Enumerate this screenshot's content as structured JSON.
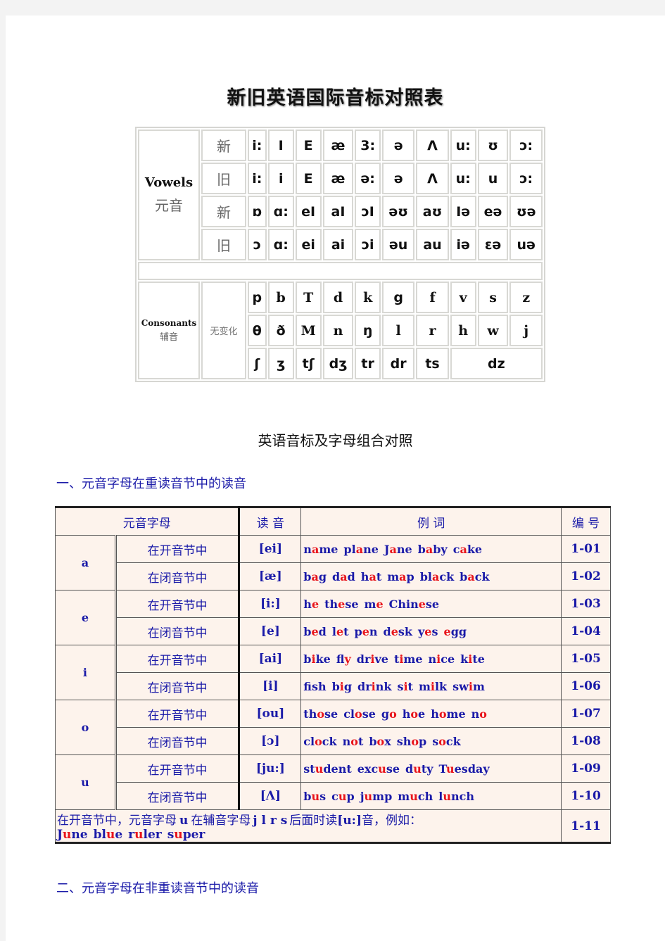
{
  "document": {
    "title": "新旧英语国际音标对照表",
    "subtitle": "英语音标及字母组合对照",
    "section1_heading": "一、元音字母在重读音节中的读音",
    "section2_heading": "二、元音字母在非重读音节中的读音"
  },
  "ipa_table": {
    "vowels_label": "Vowels",
    "vowels_cn": "元音",
    "vowel_rows": [
      {
        "label": "新",
        "symbols": [
          "i:",
          "I",
          "E",
          "æ",
          "3:",
          "ə",
          "Λ",
          "u:",
          "ʊ",
          "ɔ:"
        ]
      },
      {
        "label": "旧",
        "symbols": [
          "i:",
          "i",
          "E",
          "æ",
          "ə:",
          "ə",
          "Λ",
          "u:",
          "u",
          "ɔ:"
        ]
      },
      {
        "label": "新",
        "symbols": [
          "ɒ",
          "ɑ:",
          "eI",
          "aI",
          "ɔI",
          "əʊ",
          "aʊ",
          "Iə",
          "eə",
          "ʊə"
        ]
      },
      {
        "label": "旧",
        "symbols": [
          "ɔ",
          "ɑ:",
          "ei",
          "ai",
          "ɔi",
          "əu",
          "au",
          "iə",
          "ɛə",
          "uə"
        ]
      }
    ],
    "consonants_label": "Consonants",
    "consonants_cn": "辅音",
    "consonants_note": "无变化",
    "consonant_rows": [
      [
        "p",
        "b",
        "T",
        "d",
        "k",
        "g",
        "f",
        "v",
        "s",
        "z"
      ],
      [
        "θ",
        "ð",
        "M",
        "n",
        "ŋ",
        "l",
        "r",
        "h",
        "w",
        "j"
      ],
      [
        "ʃ",
        "ʒ",
        "tʃ",
        "dʒ",
        "tr",
        "dr",
        "ts",
        "dz"
      ]
    ]
  },
  "letter_table": {
    "headers": [
      "元音字母",
      "读 音",
      "例 词",
      "编 号"
    ],
    "groups": [
      {
        "letter": "a",
        "rows": [
          {
            "syllable": "在开音节中",
            "sound": "[ei]",
            "words": [
              [
                "n",
                "a",
                "me"
              ],
              [
                "pl",
                "a",
                "ne"
              ],
              [
                "J",
                "a",
                "ne"
              ],
              [
                "b",
                "a",
                "by"
              ],
              [
                "c",
                "a",
                "ke"
              ]
            ],
            "code": "1-01"
          },
          {
            "syllable": "在闭音节中",
            "sound": "[æ]",
            "words": [
              [
                "b",
                "a",
                "g"
              ],
              [
                "d",
                "a",
                "d"
              ],
              [
                "h",
                "a",
                "t"
              ],
              [
                "m",
                "a",
                "p"
              ],
              [
                "bl",
                "a",
                "ck"
              ],
              [
                "b",
                "a",
                "ck"
              ]
            ],
            "code": "1-02"
          }
        ]
      },
      {
        "letter": "e",
        "rows": [
          {
            "syllable": "在开音节中",
            "sound": "[i:]",
            "words": [
              [
                "h",
                "e",
                ""
              ],
              [
                "th",
                "e",
                "se"
              ],
              [
                "m",
                "e",
                ""
              ],
              [
                "Chin",
                "e",
                "se"
              ]
            ],
            "code": "1-03"
          },
          {
            "syllable": "在闭音节中",
            "sound": "[e]",
            "words": [
              [
                "b",
                "e",
                "d"
              ],
              [
                "l",
                "e",
                "t"
              ],
              [
                "p",
                "e",
                "n"
              ],
              [
                "d",
                "e",
                "sk"
              ],
              [
                "y",
                "e",
                "s"
              ],
              [
                "",
                "e",
                "gg"
              ]
            ],
            "code": "1-04"
          }
        ]
      },
      {
        "letter": "i",
        "rows": [
          {
            "syllable": "在开音节中",
            "sound": "[ai]",
            "words": [
              [
                "b",
                "i",
                "ke"
              ],
              [
                "fl",
                "y",
                ""
              ],
              [
                "dr",
                "i",
                "ve"
              ],
              [
                "t",
                "i",
                "me"
              ],
              [
                "n",
                "i",
                "ce"
              ],
              [
                "k",
                "i",
                "te"
              ]
            ],
            "code": "1-05"
          },
          {
            "syllable": "在闭音节中",
            "sound": "[i]",
            "words": [
              [
                "f",
                "i",
                "sh"
              ],
              [
                "b",
                "i",
                "g"
              ],
              [
                "dr",
                "i",
                "nk"
              ],
              [
                "s",
                "i",
                "t"
              ],
              [
                "m",
                "i",
                "lk"
              ],
              [
                "sw",
                "i",
                "m"
              ]
            ],
            "code": "1-06"
          }
        ]
      },
      {
        "letter": "o",
        "rows": [
          {
            "syllable": "在开音节中",
            "sound": "[ou]",
            "words": [
              [
                "th",
                "o",
                "se"
              ],
              [
                "cl",
                "o",
                "se"
              ],
              [
                "g",
                "o",
                ""
              ],
              [
                "h",
                "o",
                "e"
              ],
              [
                "h",
                "o",
                "me"
              ],
              [
                "n",
                "o",
                ""
              ]
            ],
            "code": "1-07"
          },
          {
            "syllable": "在闭音节中",
            "sound": "[ɔ]",
            "words": [
              [
                "cl",
                "o",
                "ck"
              ],
              [
                "n",
                "o",
                "t"
              ],
              [
                "b",
                "o",
                "x"
              ],
              [
                "sh",
                "o",
                "p"
              ],
              [
                "s",
                "o",
                "ck"
              ]
            ],
            "code": "1-08"
          }
        ]
      },
      {
        "letter": "u",
        "rows": [
          {
            "syllable": "在开音节中",
            "sound": "[ju:]",
            "words": [
              [
                "st",
                "u",
                "dent"
              ],
              [
                "exc",
                "u",
                "se"
              ],
              [
                "d",
                "u",
                "ty"
              ],
              [
                "T",
                "u",
                "esday"
              ]
            ],
            "code": "1-09"
          },
          {
            "syllable": "在闭音节中",
            "sound": "[Λ]",
            "words": [
              [
                "b",
                "u",
                "s"
              ],
              [
                "c",
                "u",
                "p"
              ],
              [
                "j",
                "u",
                "mp"
              ],
              [
                "m",
                "u",
                "ch"
              ],
              [
                "l",
                "u",
                "nch"
              ]
            ],
            "code": "1-10"
          }
        ]
      }
    ],
    "note_row": {
      "text_prefix": "在开音节中，元音字母",
      "letter": "u",
      "text_mid": "在辅音字母",
      "consonants": "j l r s",
      "text_after": "后面时读",
      "sound": "[u:]",
      "text_end": "音，例如：",
      "words": [
        [
          "J",
          "u",
          "ne"
        ],
        [
          "bl",
          "u",
          "e"
        ],
        [
          "r",
          "u",
          "ler"
        ],
        [
          "s",
          "u",
          "per"
        ]
      ],
      "code": "1-11"
    }
  },
  "colors": {
    "heading_blue": "#1a1aa8",
    "highlight_red": "#e8141b",
    "table_bg": "#fdf3ec"
  }
}
